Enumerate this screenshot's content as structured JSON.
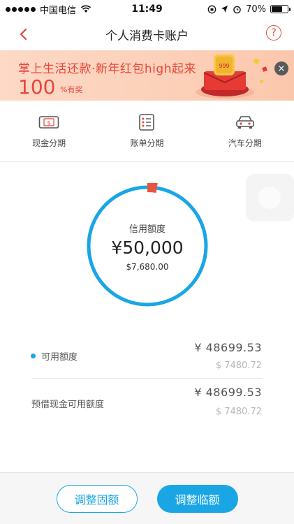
{
  "status_bar": {
    "carrier": "中国电信",
    "time": "11:49",
    "battery": "70%",
    "battery_level": 0.7
  },
  "nav": {
    "title": "个人消费卡账户",
    "help": "?"
  },
  "banner": {
    "headline": "掌上生活还款·新年红包high起来",
    "amount": "100",
    "suffix": "%有奖",
    "art_label": "999",
    "close": "×"
  },
  "quick_nav": [
    {
      "label": "现金分期",
      "icon": "cash-card-icon"
    },
    {
      "label": "账单分期",
      "icon": "bill-list-icon"
    },
    {
      "label": "汽车分期",
      "icon": "car-icon"
    }
  ],
  "credit": {
    "label": "信用额度",
    "amount": "¥50,000",
    "usd": "$7,680.00",
    "used_fraction": 0.026,
    "ring_color": "#1aa6e4",
    "used_color": "#e8553f"
  },
  "rows": [
    {
      "label": "可用额度",
      "value": "¥ 48699.53",
      "sub": "$ 7480.72"
    },
    {
      "label": "预借现金可用额度",
      "value": "¥ 48699.53",
      "sub": "$ 7480.72"
    }
  ],
  "buttons": {
    "fixed": "调整固额",
    "temp": "调整临额"
  },
  "colors": {
    "accent": "#1aa6e4",
    "brand_red": "#e0463c"
  }
}
